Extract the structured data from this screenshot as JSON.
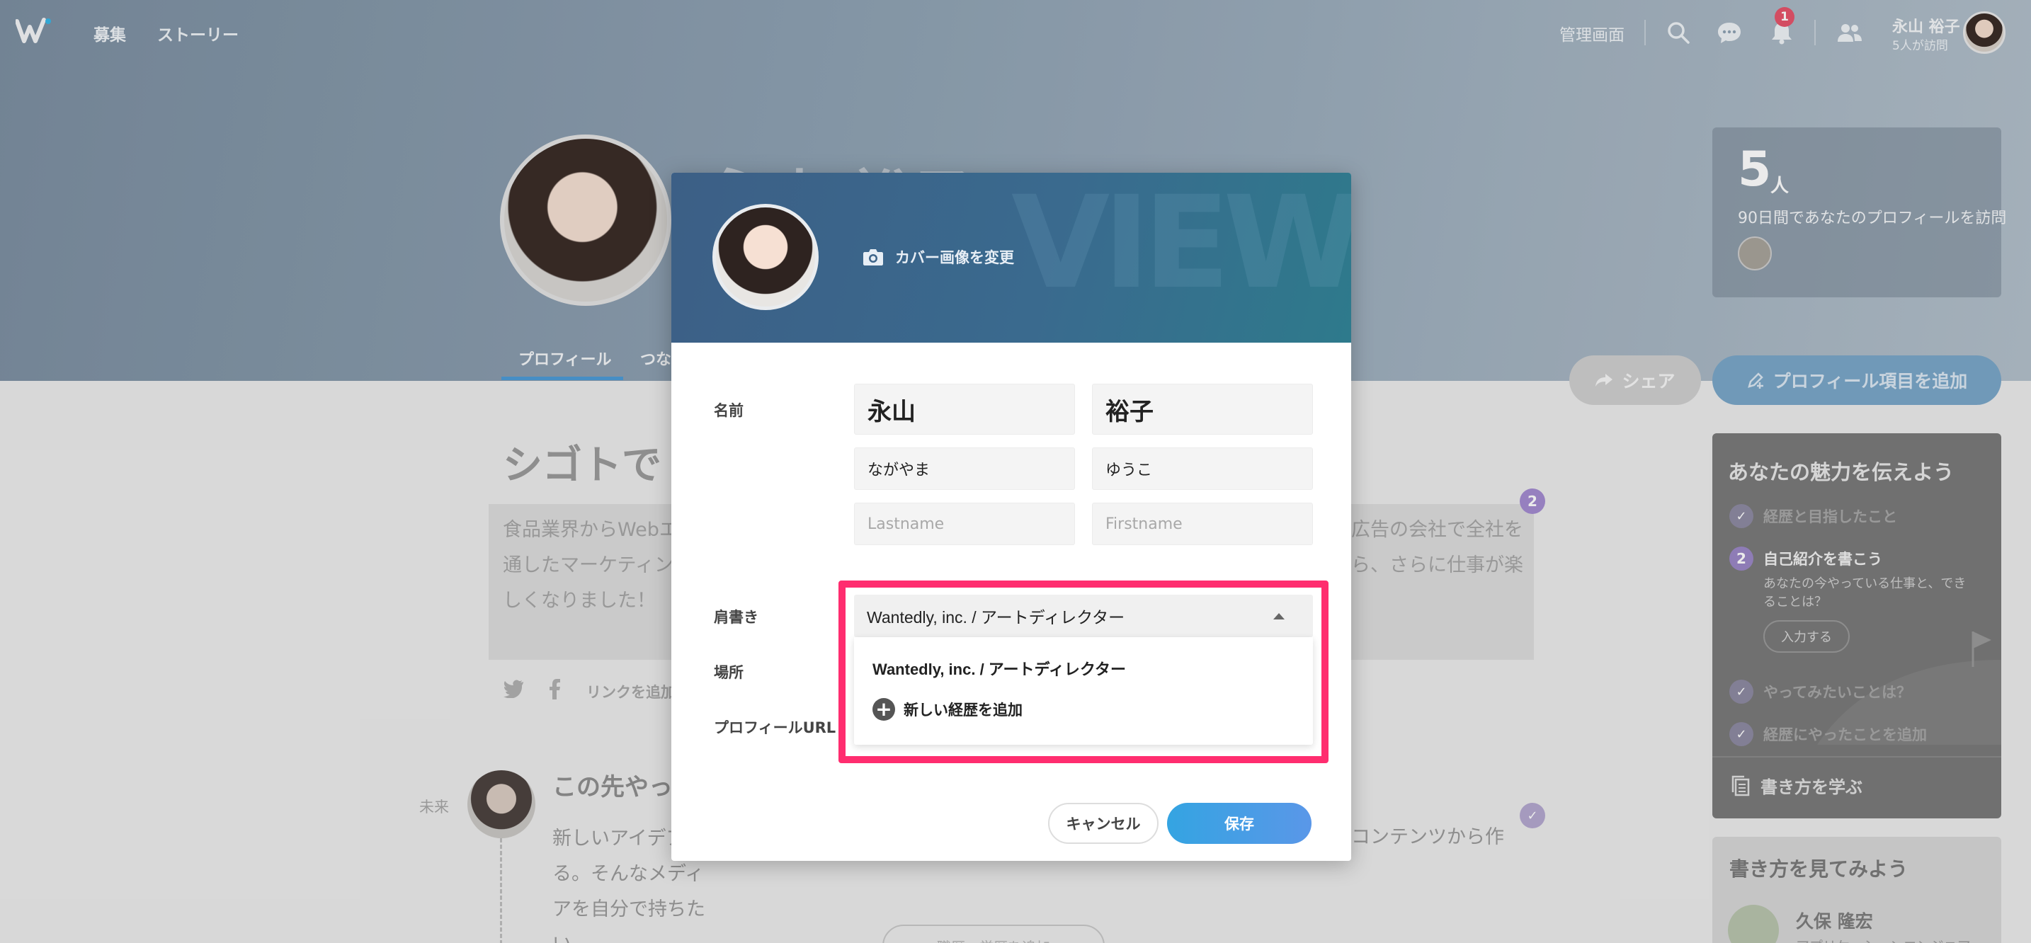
{
  "nav": {
    "links": [
      "募集",
      "ストーリー"
    ],
    "admin": "管理画面",
    "notification_count": "1",
    "user_name": "永山 裕子",
    "user_sub": "5人が訪問"
  },
  "profile": {
    "bg_name": "永山 裕子",
    "tabs": [
      "プロフィール",
      "つな"
    ]
  },
  "visitors": {
    "count": "5",
    "unit": "人",
    "desc": "90日間であなたのプロフィールを訪問"
  },
  "actions": {
    "share": "シェア",
    "add_item": "プロフィール項目を追加"
  },
  "tips": {
    "title": "あなたの魅力を伝えよう",
    "items": [
      "経歴と目指したこと",
      "自己紹介を書こう",
      "やってみたいことは？",
      "経歴にやったことを追加"
    ],
    "active_num": "2",
    "active_sub": "あなたの今やっている仕事と、できることは？",
    "input_btn": "入力する",
    "learn": "書き方を学ぶ"
  },
  "examples": {
    "title": "書き方を見てみよう",
    "name": "久保 隆宏",
    "sub": "アプリケーションエンジニア"
  },
  "background": {
    "heading": "シゴトで",
    "intro_left": "食品業界からWebエ通したマーケティンしくなりました！",
    "intro_right": "広告の会社で全社をら、さらに仕事が楽",
    "badge": "2",
    "link_add": "リンクを追加",
    "future_label": "未来",
    "future_title": "この先やっ",
    "future_left": "新しいアイデアる。そんなメディアを自分で持ちたい。",
    "future_right": "コンテンツから作",
    "bottom_btn": "職歴・学歴を追加"
  },
  "modal": {
    "change_cover": "カバー画像を変更",
    "labels": {
      "name": "名前",
      "title": "肩書き",
      "location": "場所",
      "url": "プロフィールURL"
    },
    "fields": {
      "last_name": "永山",
      "first_name": "裕子",
      "last_kana": "ながやま",
      "first_kana": "ゆうこ",
      "last_roman_placeholder": "Lastname",
      "first_roman_placeholder": "Firstname"
    },
    "title_select": {
      "selected": "Wantedly, inc. / アートディレクター",
      "options": [
        "Wantedly, inc. / アートディレクター"
      ],
      "add_new": "新しい経歴を追加"
    },
    "buttons": {
      "cancel": "キャンセル",
      "save": "保存"
    }
  }
}
